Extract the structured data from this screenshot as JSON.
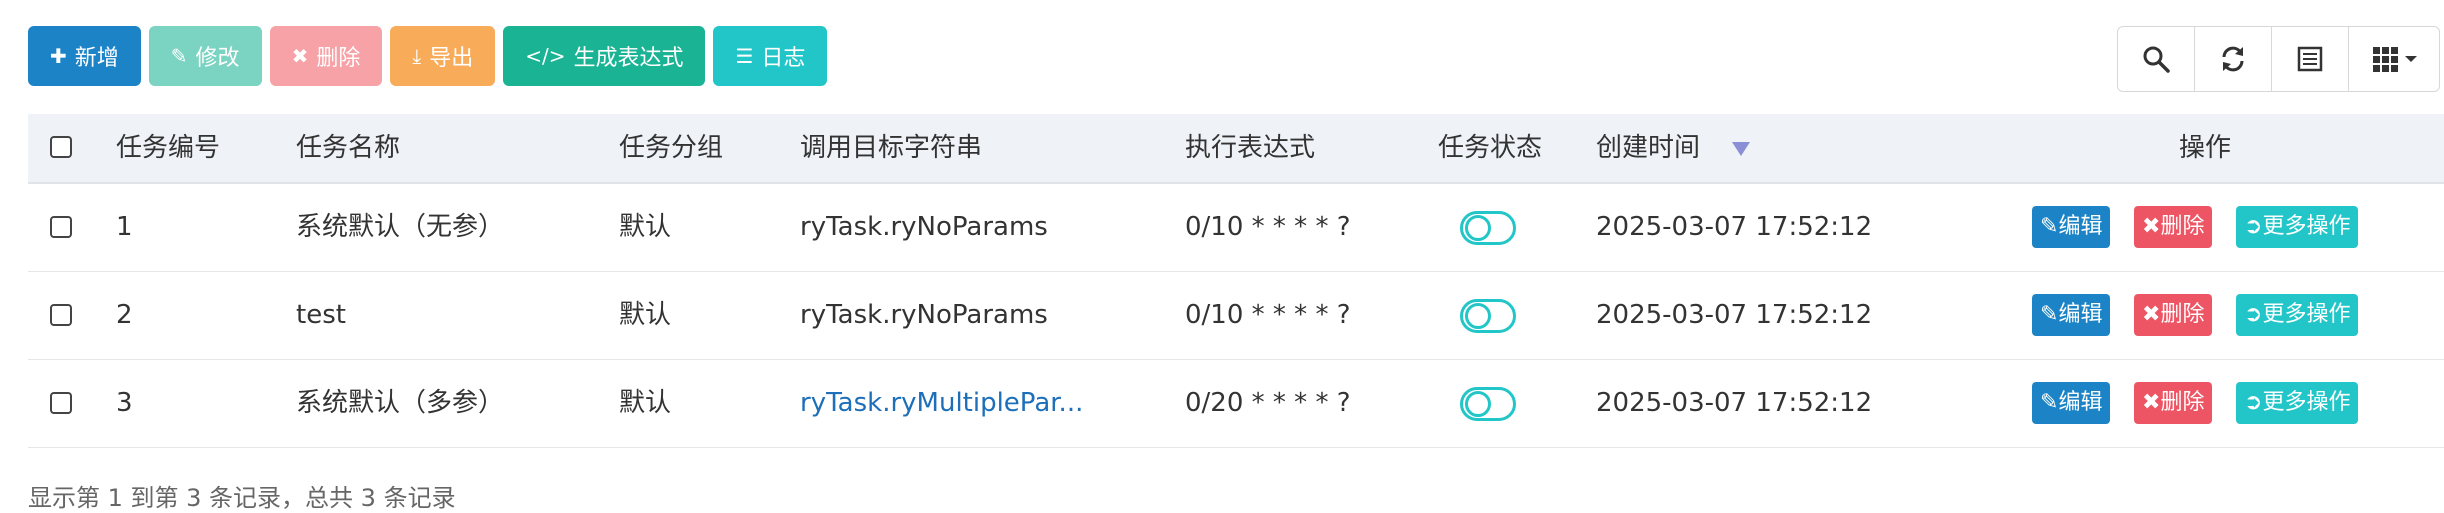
{
  "toolbar": {
    "add_label": "新增",
    "edit_label": "修改",
    "delete_label": "删除",
    "export_label": "导出",
    "generate_label": "生成表达式",
    "log_label": "日志"
  },
  "colors": {
    "primary": "#1c84c6",
    "success": "#1ab394",
    "info": "#23c6c8",
    "warning": "#f8ac59",
    "danger": "#ed5565",
    "link": "#1c6fb8"
  },
  "table": {
    "headers": [
      "任务编号",
      "任务名称",
      "任务分组",
      "调用目标字符串",
      "执行表达式",
      "任务状态",
      "创建时间",
      "操作"
    ],
    "rows": [
      {
        "id": "1",
        "name": "系统默认（无参）",
        "group": "默认",
        "target": "ryTask.ryNoParams",
        "cron": "0/10 * * * * ?",
        "status": "off",
        "created": "2025-03-07 17:52:12"
      },
      {
        "id": "2",
        "name": "test",
        "group": "默认",
        "target": "ryTask.ryNoParams",
        "cron": "0/10 * * * * ?",
        "status": "off",
        "created": "2025-03-07 17:52:12"
      },
      {
        "id": "3",
        "name": "系统默认（多参）",
        "group": "默认",
        "target": "ryTask.ryMultiplePar...",
        "cron": "0/20 * * * * ?",
        "status": "off",
        "created": "2025-03-07 17:52:12"
      }
    ],
    "actions": {
      "edit": "编辑",
      "delete": "删除",
      "more": "更多操作"
    }
  },
  "footer": {
    "text": "显示第 1 到第 3 条记录，总共 3 条记录"
  }
}
